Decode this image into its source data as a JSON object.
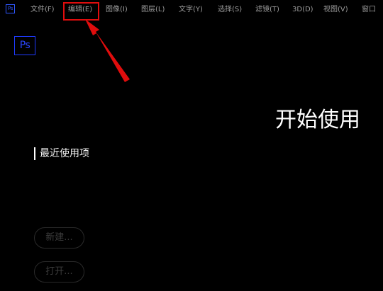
{
  "app": {
    "logo_text": "Ps",
    "small_icon_text": "Ps"
  },
  "menubar": {
    "items": [
      {
        "label": "文件(F)"
      },
      {
        "label": "编辑(E)"
      },
      {
        "label": "图像(I)"
      },
      {
        "label": "图层(L)"
      },
      {
        "label": "文字(Y)"
      },
      {
        "label": "选择(S)"
      },
      {
        "label": "滤镜(T)"
      },
      {
        "label": "3D(D)"
      },
      {
        "label": "视图(V)"
      },
      {
        "label": "窗口"
      }
    ],
    "highlighted_item_index": 1
  },
  "home": {
    "title": "开始使用",
    "recent_label": "最近使用项",
    "new_button": "新建...",
    "open_button": "打开..."
  },
  "colors": {
    "background": "#000000",
    "annotation_red": "#e00d0d",
    "ps_blue": "#1f3bff",
    "menu_text": "#9c9c9c"
  },
  "icons": {
    "menubar_app_icon": "photoshop-small-icon",
    "logo": "photoshop-logo",
    "annotation": "red-arrow-icon"
  }
}
